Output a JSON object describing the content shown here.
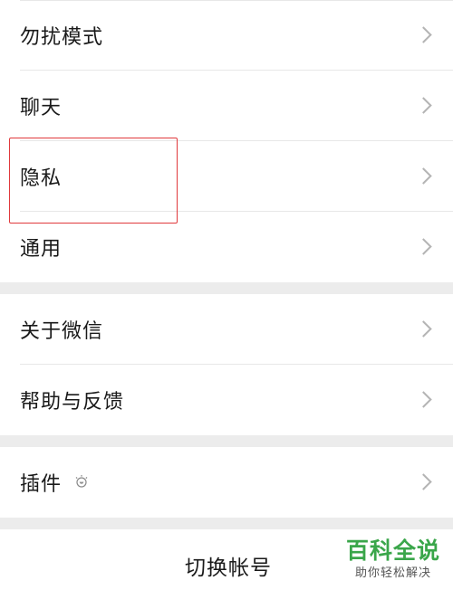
{
  "settings": {
    "group1": [
      {
        "label": "勿扰模式"
      },
      {
        "label": "聊天"
      },
      {
        "label": "隐私"
      },
      {
        "label": "通用"
      }
    ],
    "group2": [
      {
        "label": "关于微信"
      },
      {
        "label": "帮助与反馈"
      }
    ],
    "group3": [
      {
        "label": "插件",
        "icon": "lightbulb-icon"
      }
    ],
    "switch_account": "切换帐号"
  },
  "watermark": {
    "title": "百科全说",
    "subtitle": "助你轻松解决"
  },
  "colors": {
    "highlight": "#e0393c",
    "watermark": "#3aa64a",
    "separator": "#ececec"
  }
}
